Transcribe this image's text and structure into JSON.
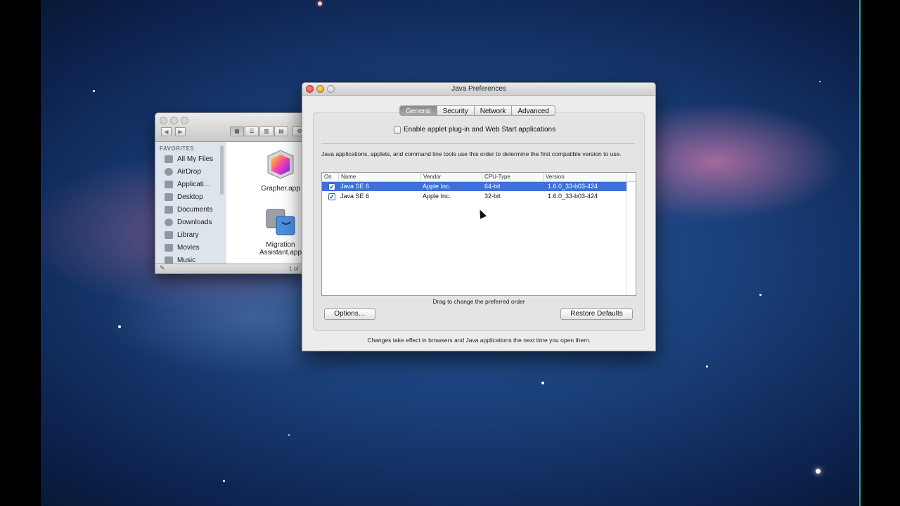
{
  "finder": {
    "sidebar_heading": "FAVORITES",
    "sidebar_items": [
      {
        "label": "All My Files",
        "icon": "all-files-icon"
      },
      {
        "label": "AirDrop",
        "icon": "airdrop-icon"
      },
      {
        "label": "Applicati…",
        "icon": "applications-icon"
      },
      {
        "label": "Desktop",
        "icon": "desktop-icon"
      },
      {
        "label": "Documents",
        "icon": "documents-icon"
      },
      {
        "label": "Downloads",
        "icon": "downloads-icon"
      },
      {
        "label": "Library",
        "icon": "folder-icon"
      },
      {
        "label": "Movies",
        "icon": "movies-icon"
      },
      {
        "label": "Music",
        "icon": "music-icon"
      }
    ],
    "files": [
      {
        "label": "Grapher.app"
      },
      {
        "label_line1": "Migration",
        "label_line2": "Assistant.app"
      }
    ],
    "status": "1 of"
  },
  "java": {
    "title": "Java Preferences",
    "tabs": [
      {
        "label": "General",
        "selected": true
      },
      {
        "label": "Security",
        "selected": false
      },
      {
        "label": "Network",
        "selected": false
      },
      {
        "label": "Advanced",
        "selected": false
      }
    ],
    "enable_applet_label": "Enable applet plug-in and Web Start applications",
    "enable_applet_checked": false,
    "description": "Java applications, applets, and command line tools use this order to determine the first compatible version to use.",
    "table": {
      "headers": [
        "On",
        "Name",
        "Vendor",
        "CPU-Type",
        "Version"
      ],
      "rows": [
        {
          "on": true,
          "name": "Java SE 6",
          "vendor": "Apple Inc.",
          "cpu": "64-bit",
          "version": "1.6.0_33-b03-424",
          "selected": true
        },
        {
          "on": true,
          "name": "Java SE 6",
          "vendor": "Apple Inc.",
          "cpu": "32-bit",
          "version": "1.6.0_33-b03-424",
          "selected": false
        }
      ]
    },
    "drag_hint": "Drag to change the preferred order",
    "options_button": "Options…",
    "restore_button": "Restore Defaults",
    "footer_note": "Changes take effect in browsers and Java applications the next time you open them."
  },
  "colors": {
    "selection": "#3f6fd8",
    "close": "#e0443e",
    "minimize": "#dea123",
    "zoom": "#c8c8c8"
  }
}
